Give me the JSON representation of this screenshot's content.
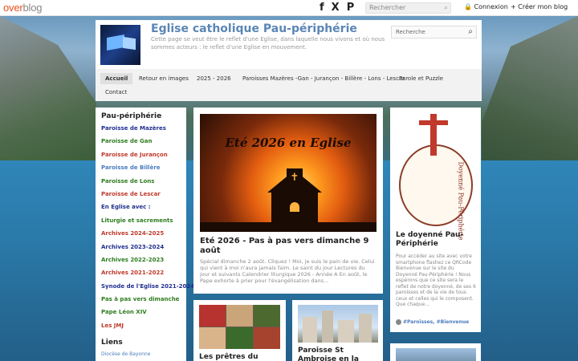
{
  "topbar": {
    "logo_over": "over",
    "logo_blog": "blog",
    "social": [
      "f",
      "X",
      "P"
    ],
    "search_placeholder": "Rechercher",
    "login": "🔒 Connexion",
    "create_blog": "+ Créer mon blog"
  },
  "header": {
    "title": "Eglise catholique Pau-périphérie",
    "description": "Cette page se veut être le reflet d'une Eglise, dans laquelle nous vivons et où nous sommes acteurs : le reflet d'une Eglise en mouvement.",
    "search_placeholder": "Recherche"
  },
  "nav": {
    "items": [
      "Accueil",
      "Retour en images",
      "2025 - 2026",
      "Paroisses Mazères -Gan - Jurançon - Billère - Lons - Lescar",
      "Parole et Puzzle",
      "Contact"
    ]
  },
  "sidebar": {
    "title": "Pau-périphérie",
    "items": [
      {
        "label": "Paroisse de Mazères",
        "color": "#1f2f8f"
      },
      {
        "label": "Paroisse de Gan",
        "color": "#2e7d1f"
      },
      {
        "label": "Paroisse de Jurançon",
        "color": "#c0392b"
      },
      {
        "label": "Paroisse de Billère",
        "color": "#4a7bbf"
      },
      {
        "label": "Paroisse de Lons",
        "color": "#2e7d1f"
      },
      {
        "label": "Paroisse de Lescar",
        "color": "#c0392b"
      },
      {
        "label": "En Eglise avec :",
        "color": "#1f2f8f"
      },
      {
        "label": "Liturgie et sacrements",
        "color": "#2e7d1f"
      },
      {
        "label": "Archives 2024-2025",
        "color": "#c0392b"
      },
      {
        "label": "Archives 2023-2024",
        "color": "#1f2f8f"
      },
      {
        "label": "Archives 2022-2023",
        "color": "#2e7d1f"
      },
      {
        "label": "Archives 2021-2022",
        "color": "#c0392b"
      },
      {
        "label": "Synode de l'Eglise 2021-2024",
        "color": "#1f2f8f"
      },
      {
        "label": "Pas à pas vers dimanche",
        "color": "#2e7d1f"
      },
      {
        "label": "Pape Léon XIV",
        "color": "#2e7d1f"
      },
      {
        "label": "Les JMJ",
        "color": "#c0392b"
      }
    ],
    "liens_title": "Liens",
    "liens_first": "Diocèse de Bayonne"
  },
  "posts": {
    "main": {
      "image_caption": "Eté 2026 en Eglise",
      "title": "Eté 2026 - Pas à pas vers dimanche 9 août",
      "excerpt": "Spécial dimanche 2 août. Cliquez ! Moi, je suis le pain de vie. Celui qui vient à moi n'aura jamais faim. Le saint du jour Lectures du jour et suivants Calendrier liturgique 2026 - Année A En août, le Pape exhorte à prier pour l'évangélisation dans..."
    },
    "right": {
      "seal_text": "Doyenné Pau-Périphérie",
      "title": "Le doyenné Pau-Périphérie",
      "excerpt": "Pour accéder au site avec votre smartphone flashez ce QRCode Bienvenue sur le site du Doyenné Pau-Périphérie ! Nous espérons que ce site sera le reflet de notre doyenné, de ses 6 paroisses et de la vie de tous ceux et celles qui le composent. Que chaque...",
      "tags": "#Paroisses, #Bienvenue"
    },
    "small1": {
      "title": "Les prêtres du"
    },
    "small2": {
      "title": "Paroisse St Ambroise en la Vallée"
    }
  }
}
